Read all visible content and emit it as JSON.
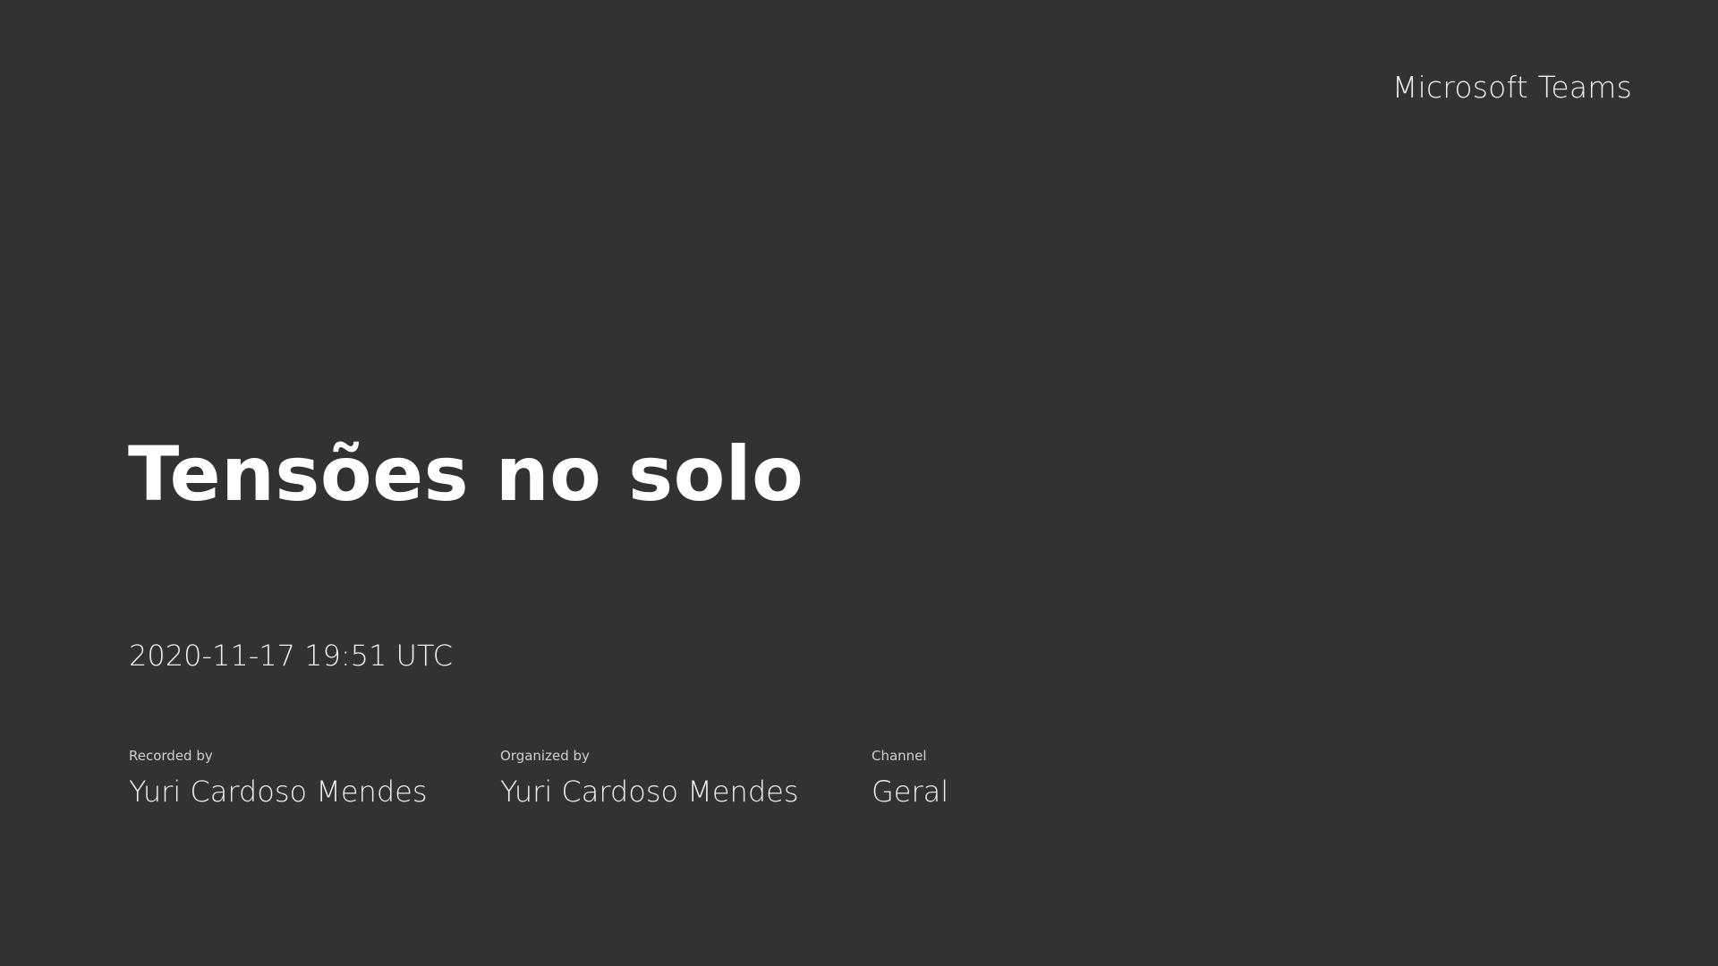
{
  "brand": "Microsoft Teams",
  "meeting": {
    "title": "Tensões no solo",
    "timestamp": "2020-11-17 19:51 UTC"
  },
  "details": {
    "recorded_by_label": "Recorded by",
    "recorded_by": "Yuri Cardoso Mendes",
    "organized_by_label": "Organized by",
    "organized_by": "Yuri Cardoso Mendes",
    "channel_label": "Channel",
    "channel": "Geral"
  },
  "colors": {
    "background": "#323232",
    "text": "#efefef",
    "title": "#ffffff"
  }
}
